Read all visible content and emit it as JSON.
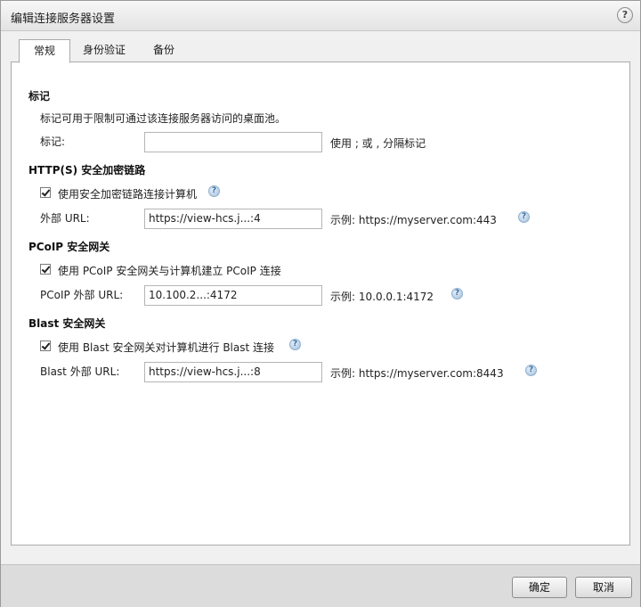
{
  "dialog": {
    "title": "编辑连接服务器设置",
    "help": "?"
  },
  "tabs": [
    {
      "label": "常规",
      "active": true
    },
    {
      "label": "身份验证",
      "active": false
    },
    {
      "label": "备份",
      "active": false
    }
  ],
  "tags": {
    "section": "标记",
    "description": "标记可用于限制可通过该连接服务器访问的桌面池。",
    "label": "标记:",
    "value": "",
    "hint": "使用 ; 或 , 分隔标记"
  },
  "https": {
    "section": "HTTP(S) 安全加密链路",
    "checkbox_label": "使用安全加密链路连接计算机",
    "checked": true,
    "url_label": "外部 URL:",
    "url_value": "https://view-hcs.j...:4",
    "example": "示例: https://myserver.com:443"
  },
  "pcoip": {
    "section": "PCoIP 安全网关",
    "checkbox_label": "使用 PCoIP 安全网关与计算机建立 PCoIP 连接",
    "checked": true,
    "url_label": "PCoIP 外部 URL:",
    "url_value": "10.100.2...:4172",
    "example": "示例: 10.0.0.1:4172"
  },
  "blast": {
    "section": "Blast 安全网关",
    "checkbox_label": "使用 Blast 安全网关对计算机进行 Blast 连接",
    "checked": true,
    "url_label": "Blast 外部 URL:",
    "url_value": "https://view-hcs.j...:8",
    "example": "示例: https://myserver.com:8443"
  },
  "footer": {
    "ok": "确定",
    "cancel": "取消"
  },
  "icons": {
    "info": "help-circle-icon",
    "check": "checkmark-icon"
  }
}
